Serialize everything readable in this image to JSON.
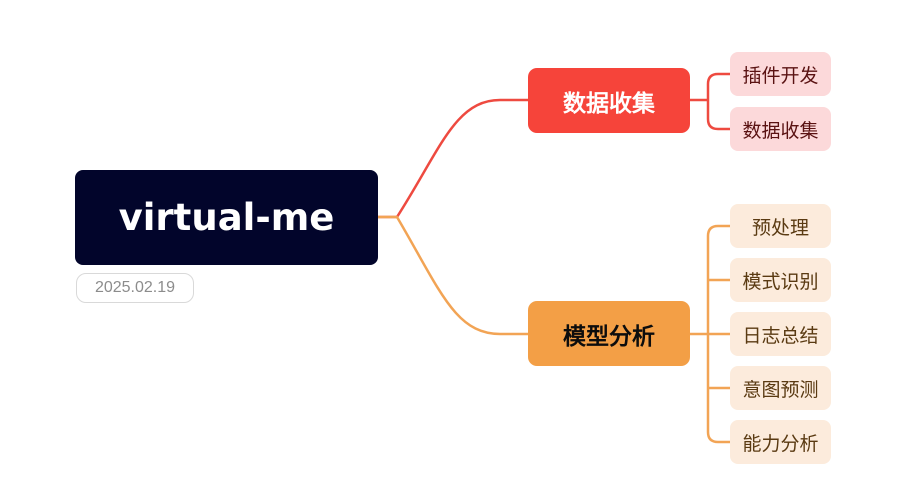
{
  "root": {
    "label": "virtual-me",
    "date": "2025.02.19",
    "color": "#02052b"
  },
  "branches": [
    {
      "label": "数据收集",
      "color": "#f6443a",
      "line_color": "#ee4a40",
      "leaf_color": "#fcd9da",
      "children": [
        "插件开发",
        "数据收集"
      ]
    },
    {
      "label": "模型分析",
      "color": "#f39f46",
      "line_color": "#f2a455",
      "leaf_color": "#fcebdc",
      "children": [
        "预处理",
        "模式识别",
        "日志总结",
        "意图预测",
        "能力分析"
      ]
    }
  ]
}
